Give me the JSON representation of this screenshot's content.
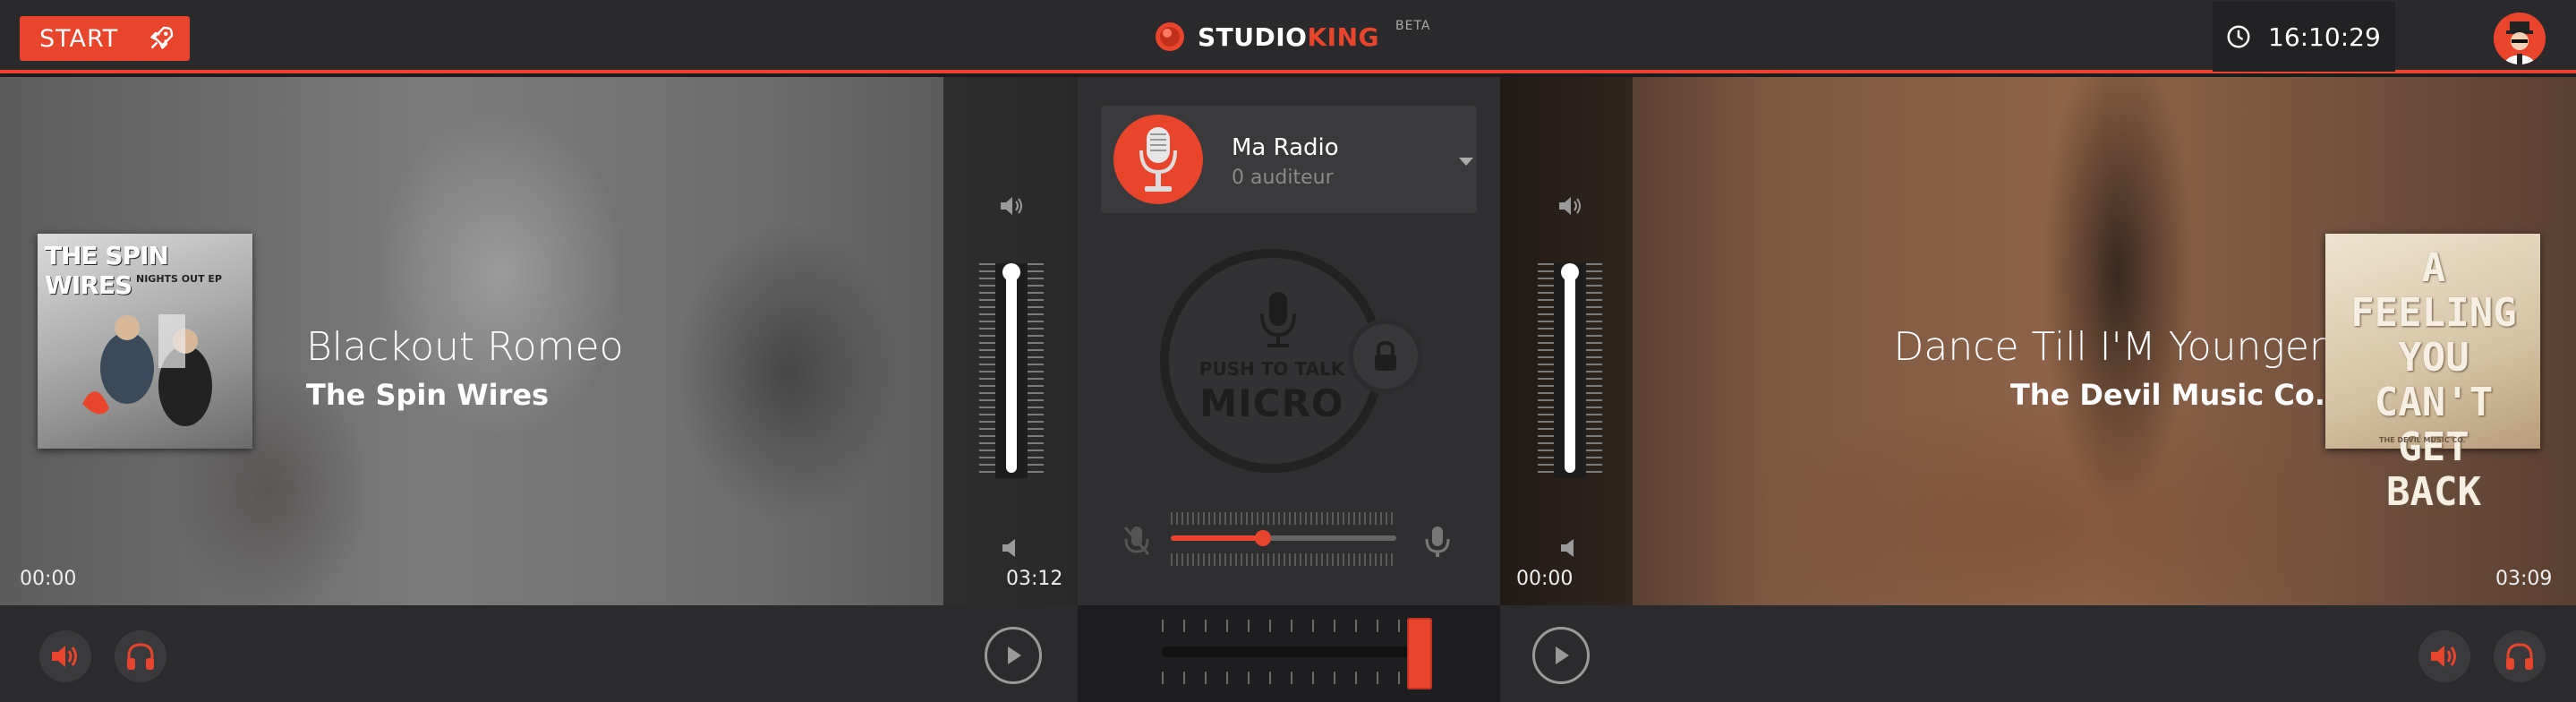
{
  "topbar": {
    "start_label": "START",
    "logo_a": "STUDIO",
    "logo_b": "KING",
    "logo_beta": "BETA",
    "clock_time": "16:10:29"
  },
  "deck_a": {
    "title": "Blackout Romeo",
    "artist": "The Spin Wires",
    "cover_title": "THE SPIN WIRES",
    "cover_subtitle": "NIGHTS OUT EP",
    "time_elapsed": "00:00",
    "time_total": "03:12",
    "volume_level": 1.0,
    "progress": 0.0
  },
  "deck_b": {
    "title": "Dance Till I'M Younger",
    "artist": "The Devil Music Co.",
    "cover_title": "A FEELING YOU CAN'T GET BACK",
    "cover_subtitle": "THE DEVIL MUSIC CO.",
    "time_elapsed": "00:00",
    "time_total": "03:09",
    "volume_level": 1.0,
    "progress": 0.0
  },
  "center": {
    "radio_name": "Ma Radio",
    "radio_listeners": "0 auditeur",
    "ptt_label": "PUSH TO TALK",
    "ptt_micro": "MICRO",
    "mic_volume": 0.4,
    "crossfader": 1.0
  },
  "colors": {
    "accent": "#e8452c",
    "background": "#2a2a2c"
  },
  "icons": [
    "rocket-icon",
    "logo-disc-icon",
    "clock-icon",
    "avatar-icon",
    "speaker-icon",
    "headphones-icon",
    "play-icon",
    "microphone-icon",
    "lock-icon",
    "mic-muted-icon",
    "caret-down-icon"
  ]
}
